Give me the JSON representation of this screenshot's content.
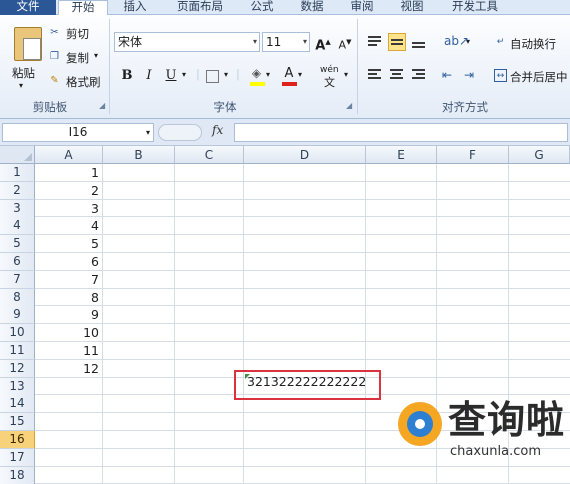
{
  "tabs": [
    "文件",
    "开始",
    "插入",
    "页面布局",
    "公式",
    "数据",
    "审阅",
    "视图",
    "开发工具"
  ],
  "clipboard": {
    "paste_label": "粘贴",
    "cut_label": "剪切",
    "copy_label": "复制",
    "format_painter_label": "格式刷",
    "group_label": "剪贴板"
  },
  "font": {
    "font_name": "宋体",
    "font_size": "11",
    "bold": "B",
    "italic": "I",
    "underline": "U",
    "grow": "A",
    "shrink": "A",
    "font_color_glyph": "A",
    "phonetic_glyph": "wén",
    "group_label": "字体"
  },
  "alignment": {
    "wrap_text_label": "自动换行",
    "merge_center_label": "合并后居中",
    "group_label": "对齐方式"
  },
  "formula_bar": {
    "name_box": "I16",
    "fx": "fx",
    "formula": ""
  },
  "columns": [
    "A",
    "B",
    "C",
    "D",
    "E",
    "F",
    "G"
  ],
  "rows": [
    "1",
    "2",
    "3",
    "4",
    "5",
    "6",
    "7",
    "8",
    "9",
    "10",
    "11",
    "12",
    "13",
    "14",
    "15",
    "16",
    "17",
    "18"
  ],
  "column_a_values": [
    "1",
    "2",
    "3",
    "4",
    "5",
    "6",
    "7",
    "8",
    "9",
    "10",
    "11",
    "12"
  ],
  "cell_d13": "321322222222222",
  "selected_row": "16",
  "colors": {
    "file_tab": "#2b5797",
    "highlight_border": "#d8333f",
    "selected_row": "#f7d27a"
  },
  "watermark": {
    "title": "查询啦",
    "url": "chaxunla.com"
  }
}
